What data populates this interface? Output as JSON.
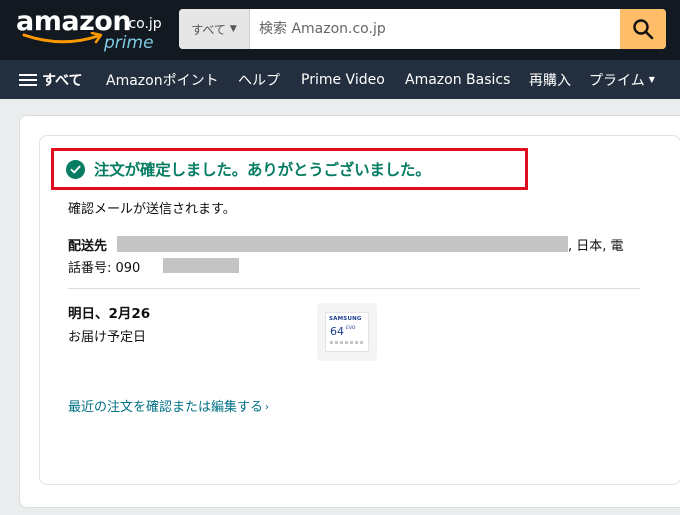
{
  "header": {
    "logo_word": "amazon",
    "logo_tld": ".co.jp",
    "logo_prime": "prime",
    "search_category": "すべて",
    "search_placeholder": "検索 Amazon.co.jp"
  },
  "nav": {
    "all_label": "すべて",
    "items": [
      "Amazonポイント",
      "ヘルプ",
      "Prime Video",
      "Amazon Basics",
      "再購入",
      "プライム"
    ]
  },
  "order": {
    "confirmation": "注文が確定しました。ありがとうございました。",
    "email_note": "確認メールが送信されます。",
    "shipping_label": "配送先",
    "shipping_tail": ", 日本, 電",
    "phone_label": "話番号: 090",
    "delivery_date": "明日、2月26",
    "delivery_sub": "お届け予定日",
    "product": {
      "brand": "SAMSUNG",
      "capacity": "64",
      "line": "EVO"
    },
    "orders_link": "最近の注文を確認または編集する"
  },
  "icons": {
    "search": "search-icon",
    "check": "check-circle-icon",
    "menu": "hamburger-menu-icon"
  },
  "colors": {
    "header_bg": "#131921",
    "nav_bg": "#232f3e",
    "search_button": "#febd69",
    "success_green": "#067d62",
    "highlight_red": "#e00d1e",
    "link": "#007185"
  }
}
